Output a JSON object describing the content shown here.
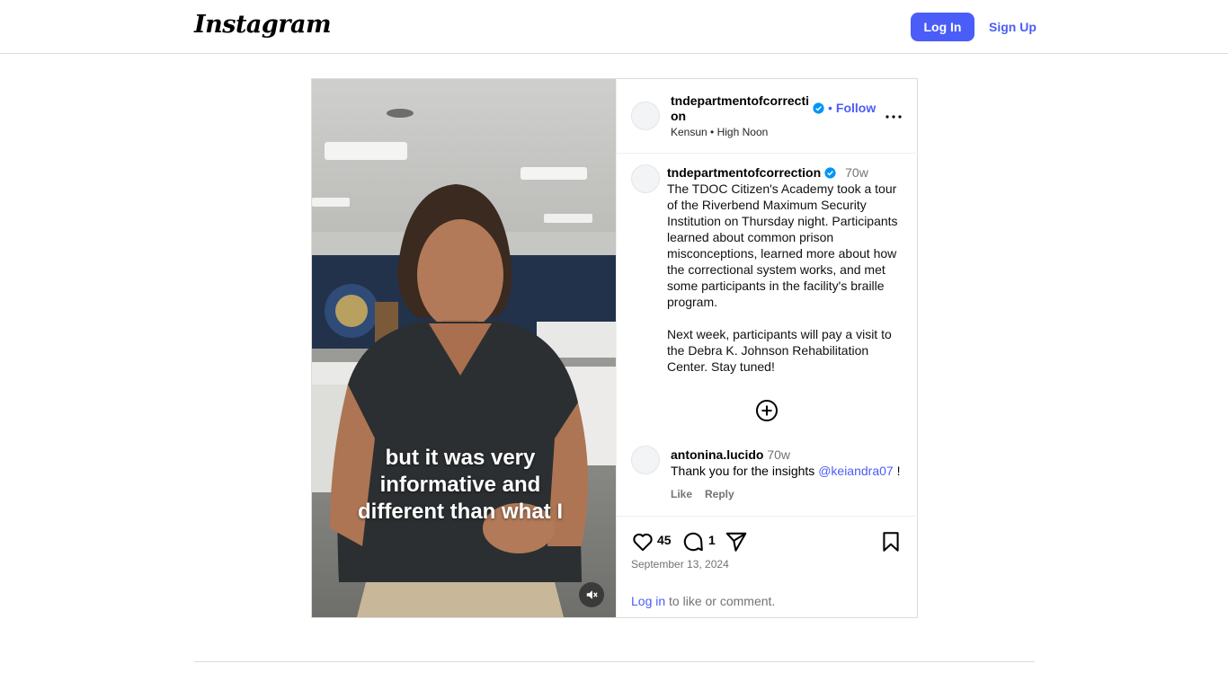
{
  "header": {
    "logo_text": "Instagram",
    "login_label": "Log In",
    "signup_label": "Sign Up"
  },
  "post": {
    "username": "tndepartmentofcorrection",
    "username_line1": "tndepartmentofcorrecti",
    "username_line2": "on",
    "follow_label": "Follow",
    "follow_dot": "•",
    "audio_artist": "Kensun",
    "audio_sep": "•",
    "audio_title": "High Noon",
    "more_icon": "more-horizontal-icon",
    "caption": {
      "time": "70w",
      "paragraph1": "The TDOC Citizen's Academy took a tour of the Riverbend Maximum Security Institution on Thursday night. Participants learned about common prison misconceptions, learned more about how the correctional system works, and met some participants in the facility's braille program.",
      "paragraph2": "Next week, participants will pay a visit to the Debra K. Johnson Rehabilitation Center. Stay tuned!"
    },
    "comments": [
      {
        "username": "antonina.lucido",
        "time": "70w",
        "text": "Thank you for the insights ",
        "mention": "@keiandra07",
        "trail": " !",
        "like_label": "Like",
        "reply_label": "Reply"
      }
    ],
    "likes_count": "45",
    "comments_count": "1",
    "date": "September 13, 2024",
    "login_prompt_link": "Log in",
    "login_prompt_rest": " to like or comment.",
    "video_subtitle_line1": "but it was very",
    "video_subtitle_line2": "informative and",
    "video_subtitle_line3": "different than what I",
    "colors": {
      "accent": "#4a5df9",
      "verified": "#0095f6",
      "border": "#dbdbdb"
    }
  }
}
